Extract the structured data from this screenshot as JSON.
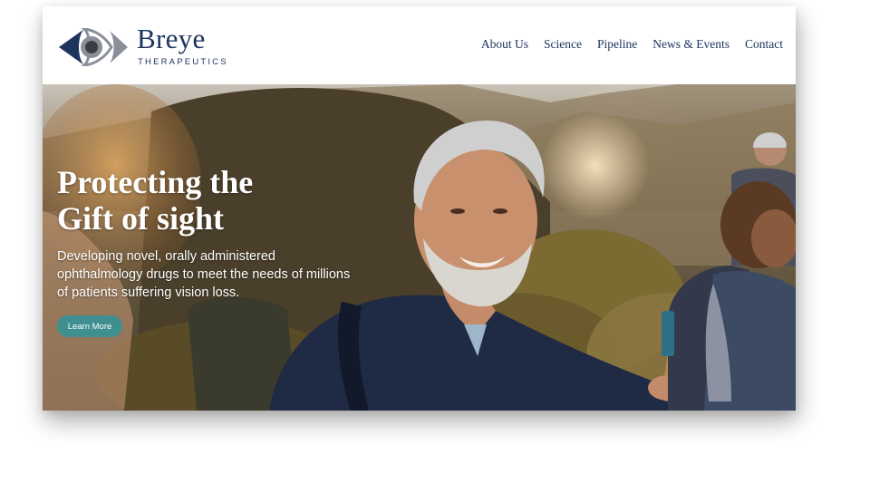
{
  "brand": {
    "name": "Breye",
    "tagline": "THERAPEUTICS",
    "colors": {
      "navy": "#1e3560",
      "gray": "#8a8f99",
      "accent": "#3f8f91"
    }
  },
  "nav": {
    "items": [
      {
        "label": "About Us"
      },
      {
        "label": "Science"
      },
      {
        "label": "Pipeline"
      },
      {
        "label": "News & Events"
      },
      {
        "label": "Contact"
      }
    ]
  },
  "hero": {
    "headline_line1": "Protecting the",
    "headline_line2": "Gift of sight",
    "subtext": "Developing novel, orally administered ophthalmology drugs to meet the needs of millions of patients suffering vision loss.",
    "cta_label": "Learn More",
    "background_image": "hikers-on-mountain-trail"
  }
}
